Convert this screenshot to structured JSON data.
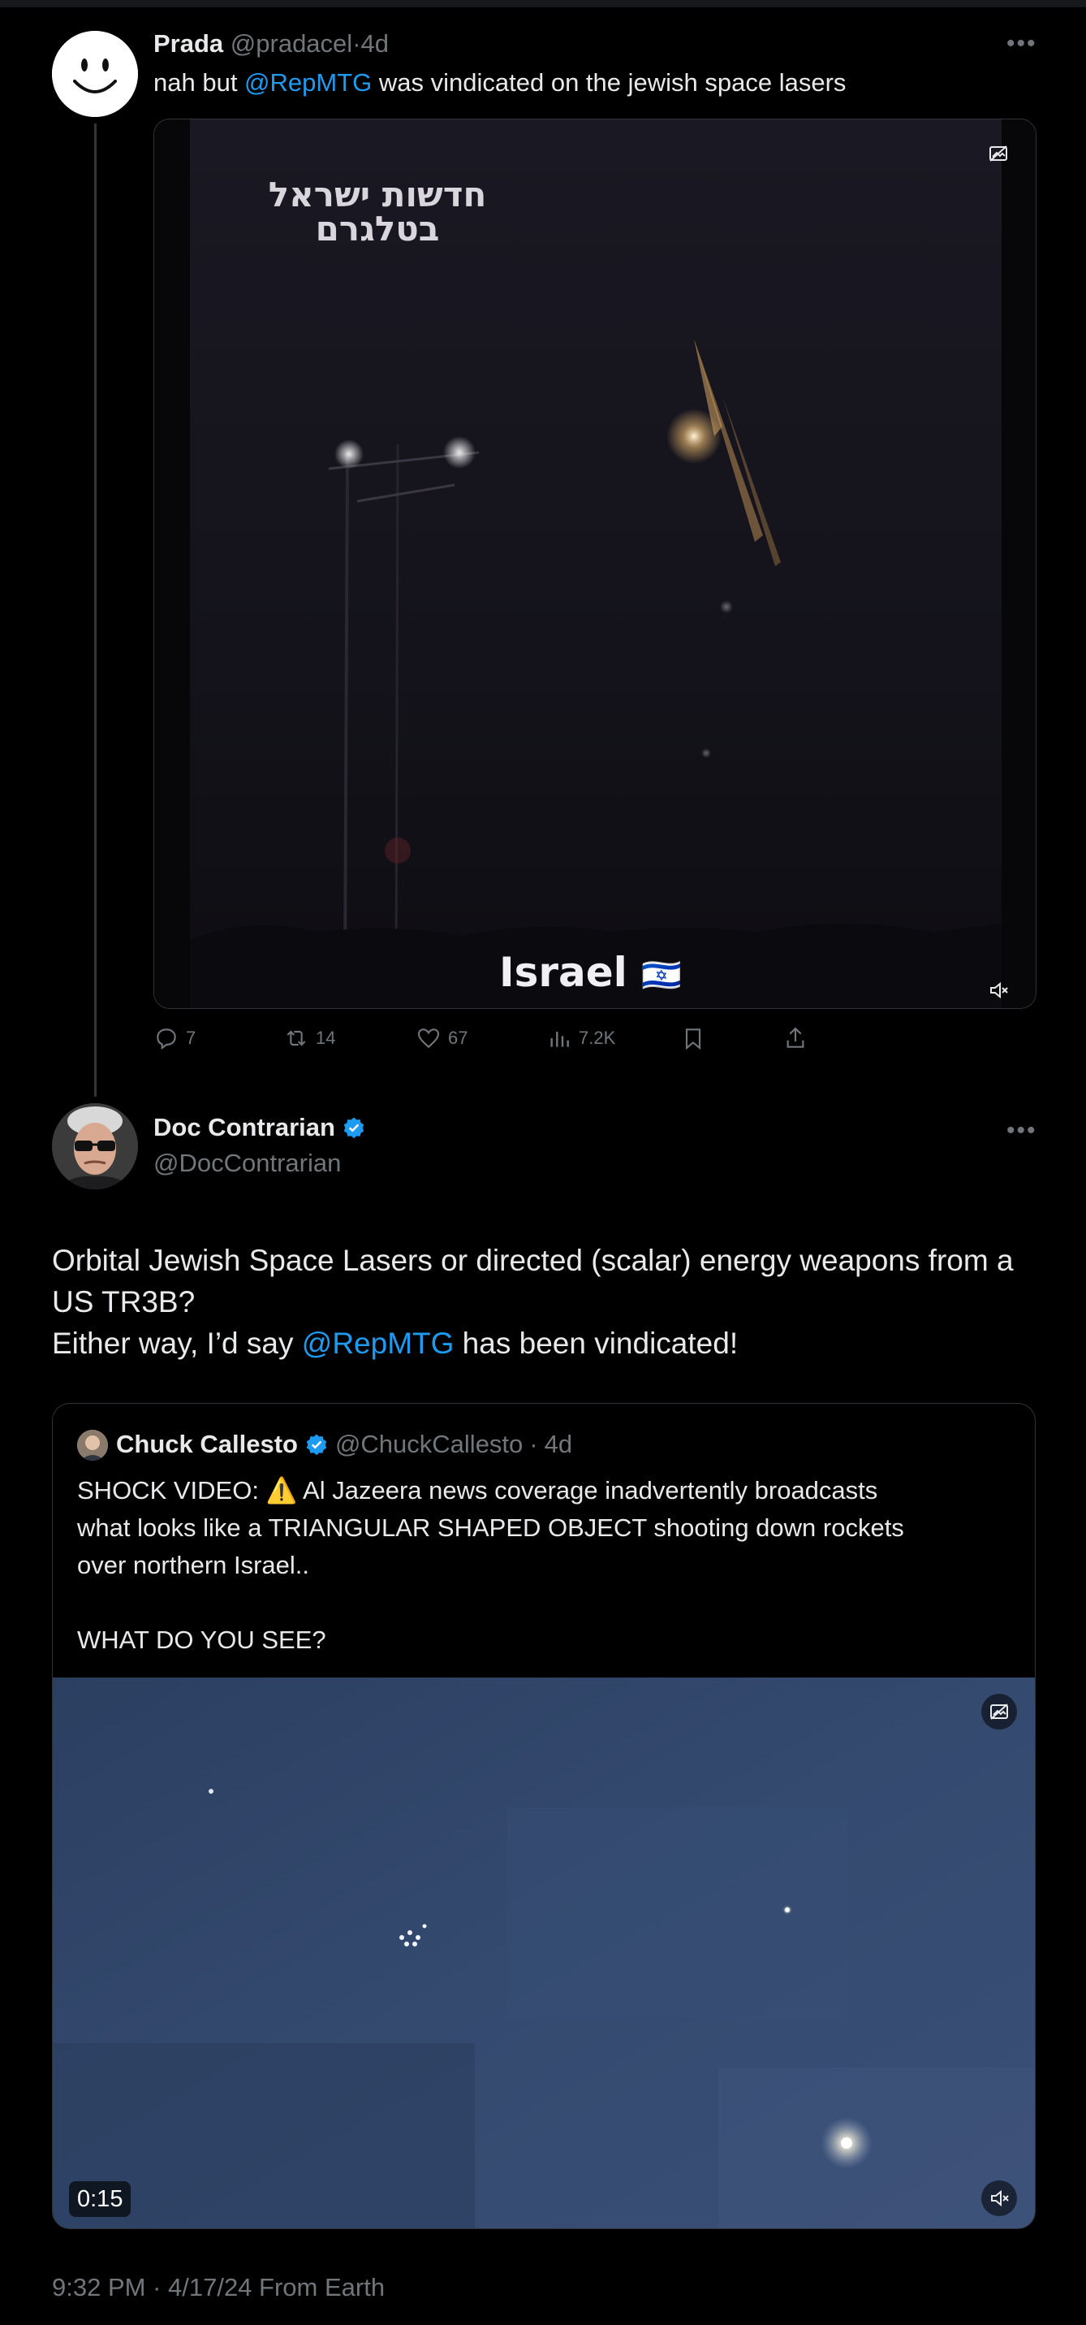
{
  "tweet1": {
    "display_name": "Prada",
    "handle": "@pradacel",
    "sep": "·",
    "time": "4d",
    "text_before": "nah but ",
    "mention": "@RepMTG",
    "text_after": " was vindicated on the jewish space lasers",
    "video_overlay_hebrew_line1": "חדשות ישראל",
    "video_overlay_hebrew_line2": "בטלגרם",
    "video_caption": "Israel",
    "video_caption_flag": "🇮🇱",
    "actions": {
      "replies": "7",
      "reposts": "14",
      "likes": "67",
      "views": "7.2K"
    },
    "more_icon": "more-horizontal-icon"
  },
  "tweet2": {
    "display_name": "Doc Contrarian",
    "handle": "@DocContrarian",
    "verified_color": "#1d9bf0",
    "line1": "Orbital Jewish Space Lasers or directed (scalar) energy weapons from a",
    "line2": "US TR3B?",
    "line3_before": "Either way, I’d say ",
    "line3_mention": "@RepMTG",
    "line3_after": " has been vindicated!",
    "timestamp": "9:32 PM · 4/17/24 From Earth"
  },
  "quote": {
    "display_name": "Chuck Callesto",
    "handle": "@ChuckCallesto",
    "sep": "·",
    "time": "4d",
    "line1_before": "SHOCK VIDEO: ",
    "line1_emoji": "⚠️",
    "line1_after": "  Al Jazeera news coverage inadvertently broadcasts",
    "line2": "what looks like a TRIANGULAR SHAPED OBJECT shooting down rockets",
    "line3": "over northern Israel..",
    "line4": "WHAT DO YOU SEE?",
    "video_duration": "0:15"
  },
  "colors": {
    "accent": "#1d9bf0",
    "muted": "#71767b",
    "text": "#e7e9ea",
    "border": "#2f3336"
  }
}
